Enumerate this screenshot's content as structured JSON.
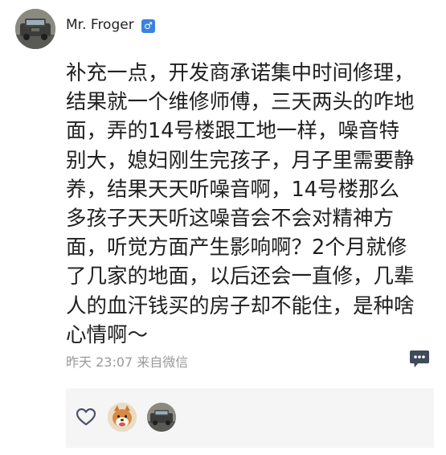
{
  "post": {
    "author": {
      "name": "Mr. Froger",
      "gender_symbol": "♂",
      "avatar_icon": "car-avatar"
    },
    "content_lines": [
      "补充一点，开发商承诺集中时间修理，",
      "结果就一个维修师傅，三天两头的咋地",
      "面，弄的14号楼跟工地一样，噪音特",
      "别大，媳妇刚生完孩子，月子里需要静",
      "养，结果天天听噪音啊，14号楼那么",
      "多孩子天天听这噪音会不会对精神方",
      "面，听觉方面产生影响啊？2个月就修",
      "了几家的地面，以后还会一直修，几辈",
      "人的血汗钱买的房子却不能住，是种啥",
      "心情啊～"
    ],
    "meta": {
      "time": "昨天 23:07",
      "source": "来自微信"
    },
    "likes": {
      "heart_icon": "heart-outline-icon",
      "liker_avatars": [
        "shiba-dog-avatar",
        "car-avatar"
      ]
    },
    "colors": {
      "badge_blue": "#3b82e0",
      "meta_gray": "#9a9a9a",
      "likes_bg": "#f5f5f5"
    }
  }
}
